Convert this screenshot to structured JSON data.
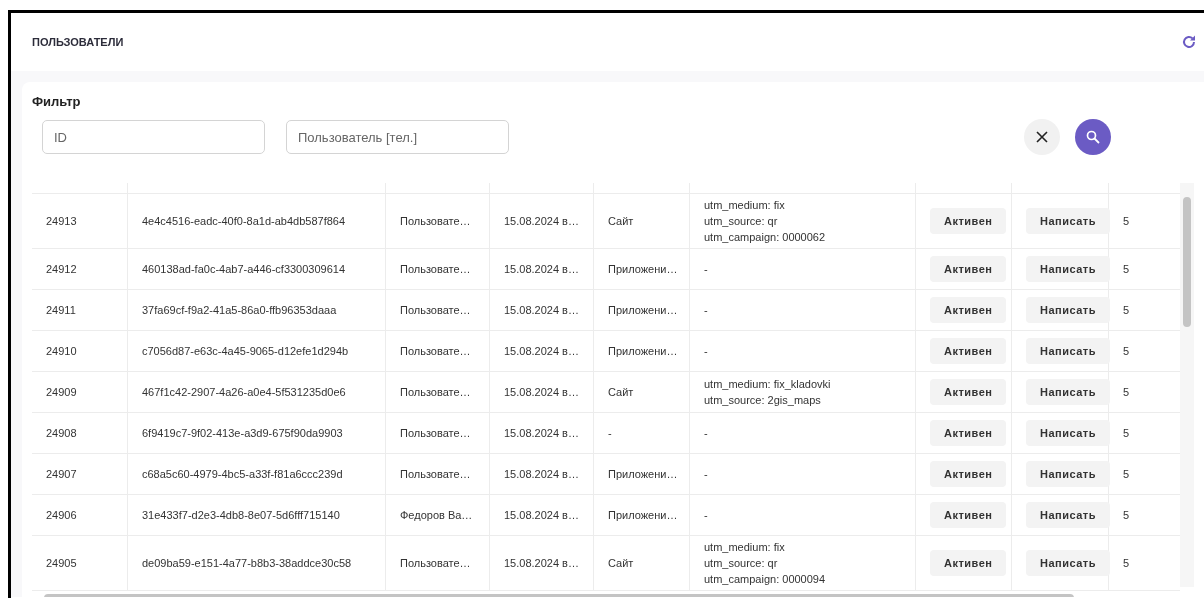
{
  "header": {
    "title": "ПОЛЬЗОВАТЕЛИ"
  },
  "filter": {
    "title": "Фильтр",
    "fields": [
      {
        "placeholder": "ID"
      },
      {
        "placeholder": "Пользователь [тел.]"
      }
    ]
  },
  "table": {
    "rows": [
      {
        "id": "24913",
        "uuid": "4e4c4516-eadc-40f0-8a1d-ab4db587f864",
        "user": "Пользовате…",
        "date": "15.08.2024 в…",
        "source": "Сайт",
        "utm": [
          "utm_medium: fix",
          "utm_source: qr",
          "utm_campaign: 0000062"
        ],
        "status": "Активен",
        "action": "Написать",
        "count": "5"
      },
      {
        "id": "24912",
        "uuid": "460138ad-fa0c-4ab7-a446-cf3300309614",
        "user": "Пользовате…",
        "date": "15.08.2024 в…",
        "source": "Приложени…",
        "utm": [
          "-"
        ],
        "status": "Активен",
        "action": "Написать",
        "count": "5"
      },
      {
        "id": "24911",
        "uuid": "37fa69cf-f9a2-41a5-86a0-ffb96353daaa",
        "user": "Пользовате…",
        "date": "15.08.2024 в…",
        "source": "Приложени…",
        "utm": [
          "-"
        ],
        "status": "Активен",
        "action": "Написать",
        "count": "5"
      },
      {
        "id": "24910",
        "uuid": "c7056d87-e63c-4a45-9065-d12efe1d294b",
        "user": "Пользовате…",
        "date": "15.08.2024 в…",
        "source": "Приложени…",
        "utm": [
          "-"
        ],
        "status": "Активен",
        "action": "Написать",
        "count": "5"
      },
      {
        "id": "24909",
        "uuid": "467f1c42-2907-4a26-a0e4-5f531235d0e6",
        "user": "Пользовате…",
        "date": "15.08.2024 в…",
        "source": "Сайт",
        "utm": [
          "utm_medium: fix_kladovki",
          "utm_source: 2gis_maps"
        ],
        "status": "Активен",
        "action": "Написать",
        "count": "5"
      },
      {
        "id": "24908",
        "uuid": "6f9419c7-9f02-413e-a3d9-675f90da9903",
        "user": "Пользовате…",
        "date": "15.08.2024 в…",
        "source": "-",
        "utm": [
          "-"
        ],
        "status": "Активен",
        "action": "Написать",
        "count": "5"
      },
      {
        "id": "24907",
        "uuid": "c68a5c60-4979-4bc5-a33f-f81a6ccc239d",
        "user": "Пользовате…",
        "date": "15.08.2024 в…",
        "source": "Приложени…",
        "utm": [
          "-"
        ],
        "status": "Активен",
        "action": "Написать",
        "count": "5"
      },
      {
        "id": "24906",
        "uuid": "31e433f7-d2e3-4db8-8e07-5d6fff715140",
        "user": "Федоров Ва…",
        "date": "15.08.2024 в…",
        "source": "Приложени…",
        "utm": [
          "-"
        ],
        "status": "Активен",
        "action": "Написать",
        "count": "5"
      },
      {
        "id": "24905",
        "uuid": "de09ba59-e151-4a77-b8b3-38addce30c58",
        "user": "Пользовате…",
        "date": "15.08.2024 в…",
        "source": "Сайт",
        "utm": [
          "utm_medium: fix",
          "utm_source: qr",
          "utm_campaign: 0000094"
        ],
        "status": "Активен",
        "action": "Написать",
        "count": "5"
      }
    ]
  }
}
